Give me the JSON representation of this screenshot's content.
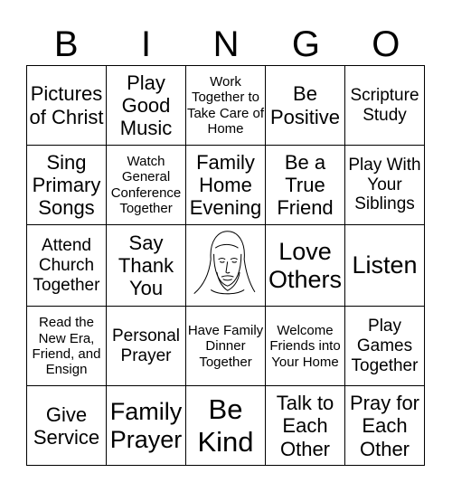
{
  "header": [
    "B",
    "I",
    "N",
    "G",
    "O"
  ],
  "cells": [
    [
      {
        "text": "Pictures of Christ",
        "size": "s3"
      },
      {
        "text": "Play Good Music",
        "size": "s3"
      },
      {
        "text": "Work Together to Take Care of Home",
        "size": "s1"
      },
      {
        "text": "Be Positive",
        "size": "s3"
      },
      {
        "text": "Scripture Study",
        "size": "s2"
      }
    ],
    [
      {
        "text": "Sing Primary Songs",
        "size": "s3"
      },
      {
        "text": "Watch General Conference Together",
        "size": "s1"
      },
      {
        "text": "Family Home Evening",
        "size": "s3"
      },
      {
        "text": "Be a True Friend",
        "size": "s3"
      },
      {
        "text": "Play With Your Siblings",
        "size": "s2"
      }
    ],
    [
      {
        "text": "Attend Church Together",
        "size": "s2"
      },
      {
        "text": "Say Thank You",
        "size": "s3"
      },
      {
        "text": "",
        "free": true,
        "image": "jesus-portrait"
      },
      {
        "text": "Love Others",
        "size": "s4"
      },
      {
        "text": "Listen",
        "size": "s4"
      }
    ],
    [
      {
        "text": "Read the New Era, Friend, and Ensign",
        "size": "s1"
      },
      {
        "text": "Personal Prayer",
        "size": "s2"
      },
      {
        "text": "Have Family Dinner Together",
        "size": "s1"
      },
      {
        "text": "Welcome Friends into Your Home",
        "size": "s1"
      },
      {
        "text": "Play Games Together",
        "size": "s2"
      }
    ],
    [
      {
        "text": "Give Service",
        "size": "s3"
      },
      {
        "text": "Family Prayer",
        "size": "s4"
      },
      {
        "text": "Be Kind",
        "size": "s5"
      },
      {
        "text": "Talk to Each Other",
        "size": "s3"
      },
      {
        "text": "Pray for Each Other",
        "size": "s3"
      }
    ]
  ]
}
